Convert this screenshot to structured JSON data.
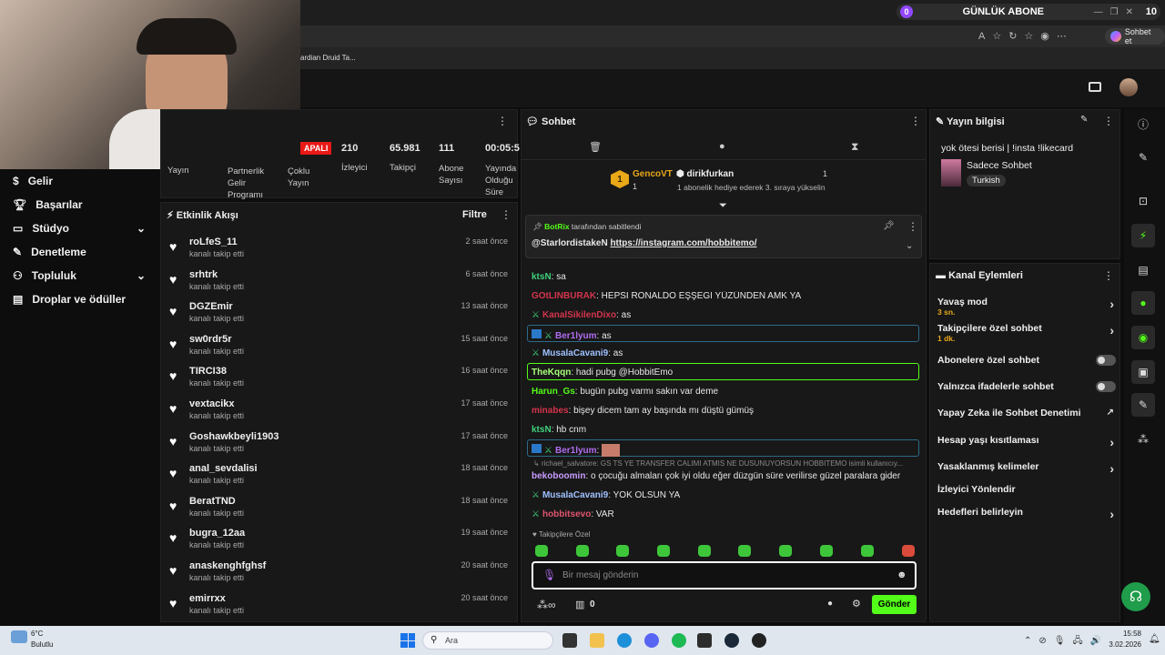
{
  "browser": {
    "bookmark": "ardian Druid Ta...",
    "chat_button": "Sohbet et"
  },
  "sub_widget": {
    "count_left": "0",
    "label": "GÜNLÜK ABONE",
    "count_right": "10"
  },
  "stats": {
    "live_badge": "APALI",
    "items": [
      {
        "value": "210",
        "label": "İzleyici"
      },
      {
        "value": "65.981",
        "label": "Takipçi"
      },
      {
        "value": "111",
        "label": "Abone Sayısı"
      },
      {
        "value": "00:05:5",
        "label": "Yayında Olduğu Süre"
      }
    ],
    "left_labels": [
      "Yayın",
      "Partnerlik Gelir Programı",
      "Çoklu Yayın"
    ]
  },
  "sidebar": {
    "items": [
      {
        "label": "Gelir",
        "icon": "dollar-icon"
      },
      {
        "label": "Başarılar",
        "icon": "trophy-icon"
      },
      {
        "label": "Stüdyo",
        "icon": "studio-icon"
      },
      {
        "label": "Denetleme",
        "icon": "wrench-icon"
      },
      {
        "label": "Topluluk",
        "icon": "community-icon"
      },
      {
        "label": "Droplar ve ödüller",
        "icon": "drops-icon"
      }
    ]
  },
  "feed": {
    "title": "Etkinlik Akışı",
    "filter": "Filtre",
    "items": [
      {
        "name": "roLfeS_11",
        "sub": "kanalı takip etti",
        "time": "2 saat önce"
      },
      {
        "name": "srhtrk",
        "sub": "kanalı takip etti",
        "time": "6 saat önce"
      },
      {
        "name": "DGZEmir",
        "sub": "kanalı takip etti",
        "time": "13 saat önce"
      },
      {
        "name": "sw0rdr5r",
        "sub": "kanalı takip etti",
        "time": "15 saat önce"
      },
      {
        "name": "TIRCI38",
        "sub": "kanalı takip etti",
        "time": "16 saat önce"
      },
      {
        "name": "vextacikx",
        "sub": "kanalı takip etti",
        "time": "17 saat önce"
      },
      {
        "name": "Goshawkbeyli1903",
        "sub": "kanalı takip etti",
        "time": "17 saat önce"
      },
      {
        "name": "anal_sevdalisi",
        "sub": "kanalı takip etti",
        "time": "18 saat önce"
      },
      {
        "name": "BeratTND",
        "sub": "kanalı takip etti",
        "time": "18 saat önce"
      },
      {
        "name": "bugra_12aa",
        "sub": "kanalı takip etti",
        "time": "19 saat önce"
      },
      {
        "name": "anaskenghfghsf",
        "sub": "kanalı takip etti",
        "time": "20 saat önce"
      },
      {
        "name": "emirrxx",
        "sub": "kanalı takip etti",
        "time": "20 saat önce"
      }
    ]
  },
  "chat": {
    "title": "Sohbet",
    "gift": {
      "rank": "1",
      "gifter": "GencoVT",
      "gifter_count": "1",
      "receiver": "dirikfurkan",
      "receiver_count": "1",
      "text": "1 abonelik hediye ederek 3. sıraya yükselin"
    },
    "pinned": {
      "by": "BotRix",
      "by_suffix": "tarafından sabitlendi",
      "author": "@StarlordistakeN",
      "link": "https://instagram.com/hobbitemo/"
    },
    "messages": [
      {
        "user": "ktsN",
        "color": "#3fd07b",
        "text": "sa"
      },
      {
        "user": "GOtLINBURAK",
        "color": "#d4344c",
        "text": "HEPSİ RONALDO EŞŞEGİ YÜZÜNDEN AMK YA"
      },
      {
        "user": "KanalSikilenDixo",
        "color": "#d4344c",
        "text": "as"
      },
      {
        "user": "Ber1lyum",
        "color": "#b06cf0",
        "text": "as"
      },
      {
        "user": "MusalaCavani9",
        "color": "#9fc1ff",
        "text": "as"
      },
      {
        "user": "TheKqqn",
        "color": "#a6ff7a",
        "text": "hadi pubg @HobbitEmo"
      },
      {
        "user": "Harun_Gs",
        "color": "#53fc18",
        "text": "bugün pubg varmı sakın var deme"
      },
      {
        "user": "minabes",
        "color": "#d4344c",
        "text": "bişey dicem tam ay başında mı düştü gümüş"
      },
      {
        "user": "ktsN",
        "color": "#3fd07b",
        "text": "hb cnm"
      },
      {
        "user": "Ber1lyum",
        "color": "#b06cf0",
        "text": ""
      },
      {
        "user": "bekoboomin",
        "color": "#c89cff",
        "text": "o çocuğu almaları çok iyi oldu eğer düzgün süre verilirse güzel paralara gider"
      },
      {
        "user": "MusalaCavani9",
        "color": "#9fc1ff",
        "text": "YOK OLSUN YA"
      },
      {
        "user": "hobbitsevo",
        "color": "#e0556e",
        "text": "VAR"
      }
    ],
    "reply": "richael_salvatore: GS TS YE TRANSFER CALIMI ATMIS NE DUSUNUYORSUN HOBBITEMO isimli kullanıcıy...",
    "followers_only": "Takipçilere Özel",
    "input_placeholder": "Bir mesaj gönderin",
    "points": "0",
    "send": "Gönder"
  },
  "stream_info": {
    "title": "Yayın bilgisi",
    "stream_title": "yok ötesi berisi | !insta !likecard",
    "category": "Sadece Sohbet",
    "tag": "Turkish"
  },
  "channel_actions": {
    "title": "Kanal Eylemleri",
    "items": [
      {
        "label": "Yavaş mod",
        "sub": "3 sn.",
        "control": "chevron"
      },
      {
        "label": "Takipçilere özel sohbet",
        "sub": "1 dk.",
        "control": "chevron"
      },
      {
        "label": "Abonelere özel sohbet",
        "sub": "",
        "control": "toggle"
      },
      {
        "label": "Yalnızca ifadelerle sohbet",
        "sub": "",
        "control": "toggle"
      },
      {
        "label": "Yapay Zeka ile Sohbet Denetimi",
        "sub": "",
        "control": "external"
      },
      {
        "label": "Hesap yaşı kısıtlaması",
        "sub": "",
        "control": "chevron"
      },
      {
        "label": "Yasaklanmış kelimeler",
        "sub": "",
        "control": "chevron"
      },
      {
        "label": "İzleyici Yönlendir",
        "sub": "",
        "control": "none"
      },
      {
        "label": "Hedefleri belirleyin",
        "sub": "",
        "control": "chevron"
      }
    ]
  },
  "taskbar": {
    "weather_temp": "6°C",
    "weather_text": "Bulutlu",
    "search": "Ara",
    "time": "15:58",
    "date": "3.02.2026"
  },
  "colors": {
    "accent": "#53fc18",
    "panel": "#181818",
    "live": "#e91916"
  }
}
